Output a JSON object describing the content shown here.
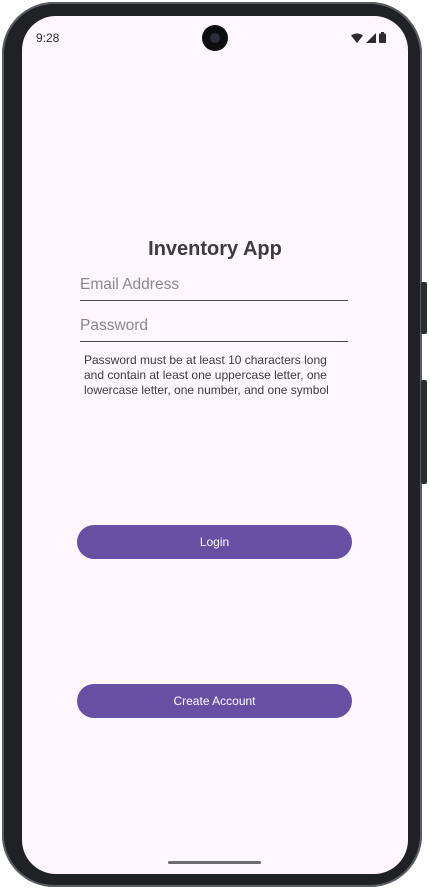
{
  "status_bar": {
    "time": "9:28",
    "icons": [
      "wifi-icon",
      "cellular-signal-icon",
      "battery-icon"
    ]
  },
  "app": {
    "title": "Inventory App"
  },
  "form": {
    "email": {
      "value": "",
      "placeholder": "Email Address"
    },
    "password": {
      "value": "",
      "placeholder": "Password"
    },
    "password_hint": "Password must be at least 10 characters long and contain at least one uppercase letter, one lowercase letter, one number, and one symbol"
  },
  "buttons": {
    "login_label": "Login",
    "create_account_label": "Create Account"
  },
  "colors": {
    "accent": "#6750a4",
    "background": "#fdf7fd"
  }
}
